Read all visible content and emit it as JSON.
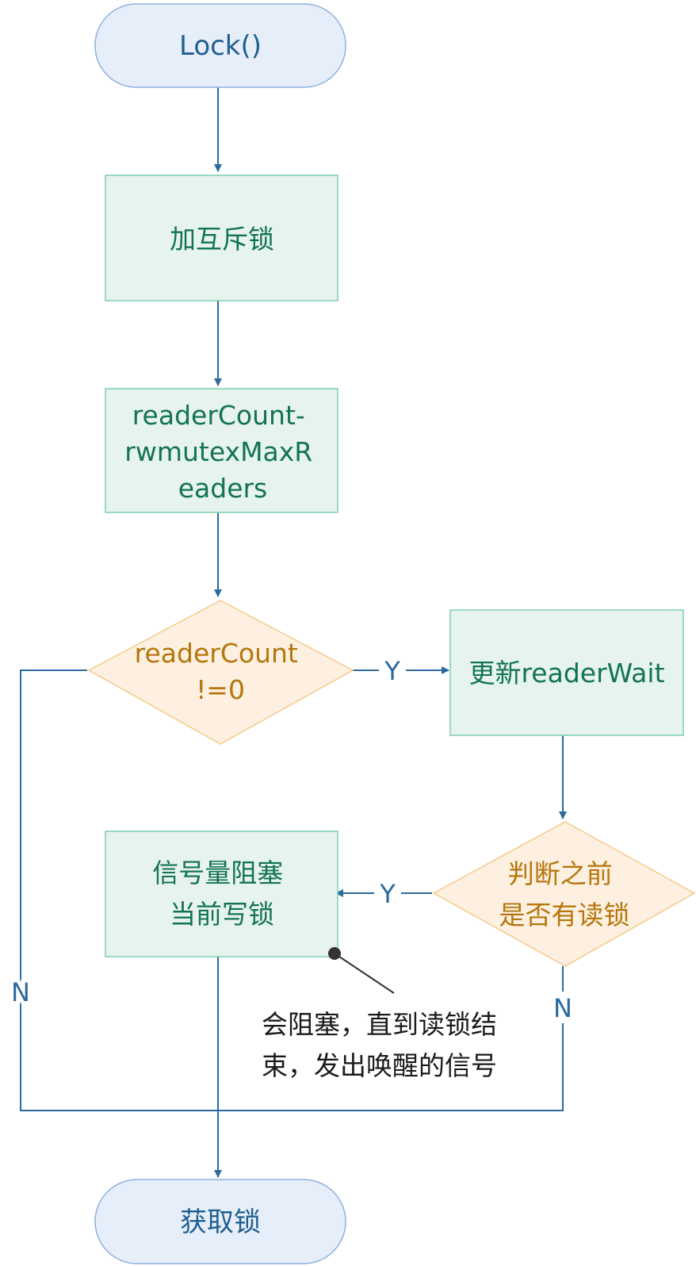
{
  "colors": {
    "edge": "#2b6a9e",
    "terminal_fill": "#e6eef9",
    "terminal_stroke": "#8cb0e0",
    "terminal_text": "#1f5f8f",
    "process_fill": "#e7f3ee",
    "process_stroke": "#7fcfae",
    "process_text": "#137356",
    "decision_fill": "#fdf0e0",
    "decision_stroke": "#f7c98a",
    "decision_text": "#b5770d",
    "note_text": "#1a1a1a",
    "note_line": "#333333"
  },
  "nodes": {
    "start": {
      "lines": [
        "Lock()"
      ]
    },
    "mutex": {
      "lines": [
        "加互斥锁"
      ]
    },
    "reader_count_update": {
      "lines": [
        "readerCount-",
        "rwmutexMaxR",
        "eaders"
      ]
    },
    "reader_count_check": {
      "lines": [
        "readerCount",
        "!=0"
      ]
    },
    "update_reader_wait": {
      "lines": [
        "更新readerWait"
      ]
    },
    "check_prior_readers": {
      "lines": [
        "判断之前",
        "是否有读锁"
      ]
    },
    "semaphore_block": {
      "lines": [
        "信号量阻塞",
        "当前写锁"
      ]
    },
    "end": {
      "lines": [
        "获取锁"
      ]
    }
  },
  "edge_labels": {
    "count_yes": "Y",
    "count_no": "N",
    "readers_yes": "Y",
    "readers_no": "N"
  },
  "note": {
    "lines": [
      "会阻塞，直到读锁结",
      "束，发出唤醒的信号"
    ]
  }
}
